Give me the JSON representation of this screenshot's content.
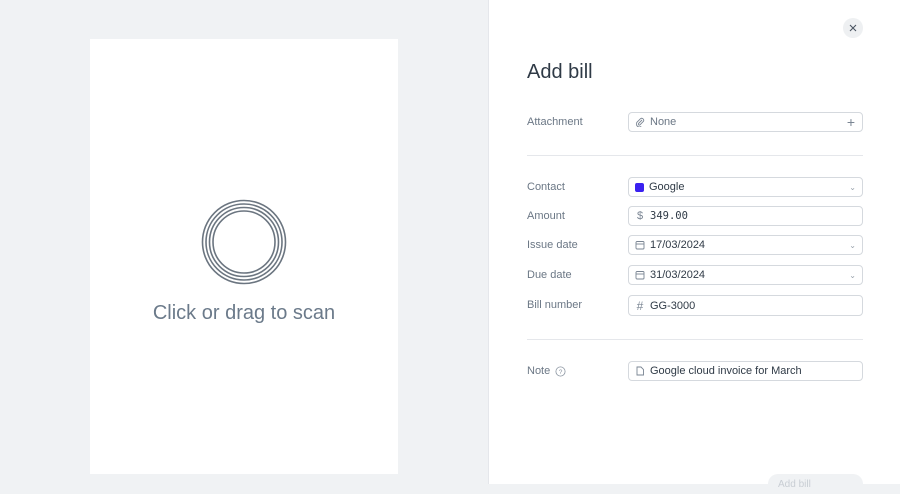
{
  "scanner": {
    "prompt": "Click or drag to scan"
  },
  "form": {
    "title": "Add bill",
    "attachment": {
      "label": "Attachment",
      "value": "None"
    },
    "contact": {
      "label": "Contact",
      "value": "Google",
      "color": "#3a21f0"
    },
    "amount": {
      "label": "Amount",
      "currency": "$",
      "value": "349.00"
    },
    "issue_date": {
      "label": "Issue date",
      "value": "17/03/2024"
    },
    "due_date": {
      "label": "Due date",
      "value": "31/03/2024"
    },
    "bill_number": {
      "label": "Bill number",
      "value": "GG-3000"
    },
    "note": {
      "label": "Note",
      "value": "Google cloud invoice for March"
    },
    "submit_label": "Add bill"
  }
}
